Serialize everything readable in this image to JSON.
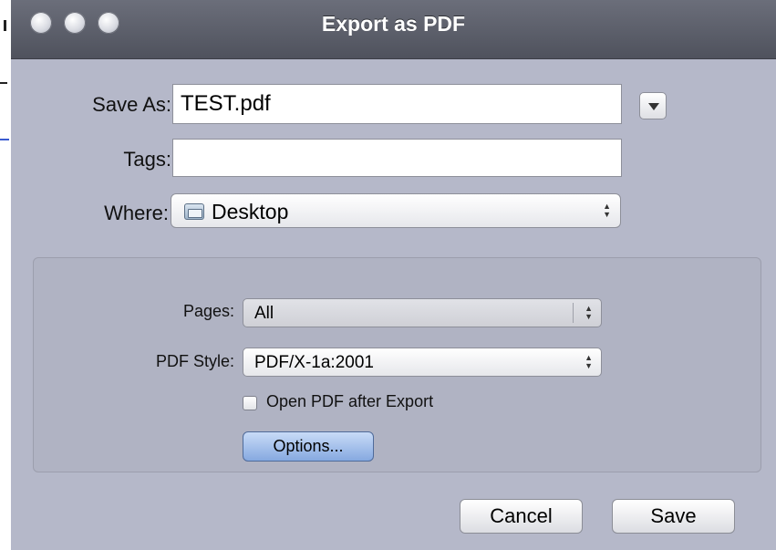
{
  "window": {
    "title": "Export as PDF",
    "traffic_lights": [
      "close",
      "minimize",
      "zoom"
    ]
  },
  "form": {
    "save_as_label": "Save As:",
    "save_as_value": "TEST.pdf",
    "tags_label": "Tags:",
    "tags_value": "",
    "where_label": "Where:",
    "where_value": "Desktop",
    "where_icon": "folder-icon"
  },
  "options": {
    "pages_label": "Pages:",
    "pages_value": "All",
    "pdf_style_label": "PDF Style:",
    "pdf_style_value": "PDF/X-1a:2001",
    "open_after_label": "Open PDF after Export",
    "open_after_checked": false,
    "options_button": "Options..."
  },
  "buttons": {
    "cancel": "Cancel",
    "save": "Save"
  },
  "colors": {
    "dialog_bg": "#b5b8c9",
    "titlebar": "#5a5d68",
    "default_button": "#9fbce9"
  }
}
